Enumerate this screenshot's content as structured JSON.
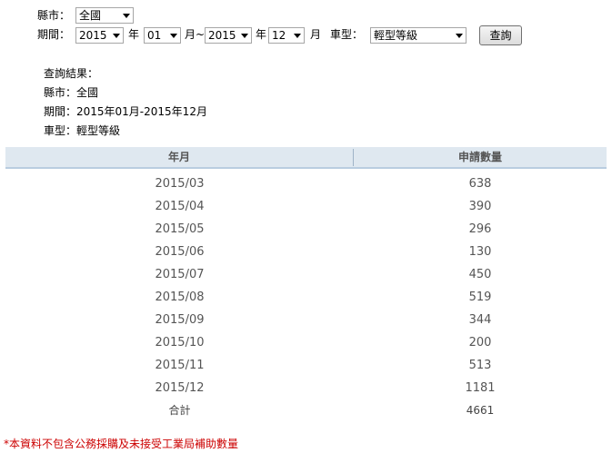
{
  "filters": {
    "county_label": "縣市：",
    "county_value": "全國",
    "period_label": "期間：",
    "start_year": "2015",
    "year_unit_1": "年",
    "start_month": "01",
    "month_unit_tilde": "月~",
    "end_year": "2015",
    "year_unit_2": "年",
    "end_month": "12",
    "month_unit_2": "月",
    "vehicle_type_label": "車型：",
    "vehicle_type_value": "輕型等級",
    "query_button": "查詢"
  },
  "result_summary": {
    "heading": "查詢結果：",
    "county_line": "縣市：全國",
    "period_line": "期間：2015年01月-2015年12月",
    "vehicle_type_line": "車型：輕型等級"
  },
  "table": {
    "columns": [
      "年月",
      "申請數量"
    ],
    "rows": [
      {
        "month": "2015/03",
        "count": "638"
      },
      {
        "month": "2015/04",
        "count": "390"
      },
      {
        "month": "2015/05",
        "count": "296"
      },
      {
        "month": "2015/06",
        "count": "130"
      },
      {
        "month": "2015/07",
        "count": "450"
      },
      {
        "month": "2015/08",
        "count": "519"
      },
      {
        "month": "2015/09",
        "count": "344"
      },
      {
        "month": "2015/10",
        "count": "200"
      },
      {
        "month": "2015/11",
        "count": "513"
      },
      {
        "month": "2015/12",
        "count": "1181"
      }
    ],
    "total_label": "合計",
    "total_value": "4661"
  },
  "footnote": "*本資料不包含公務採購及未接受工業局補助數量"
}
